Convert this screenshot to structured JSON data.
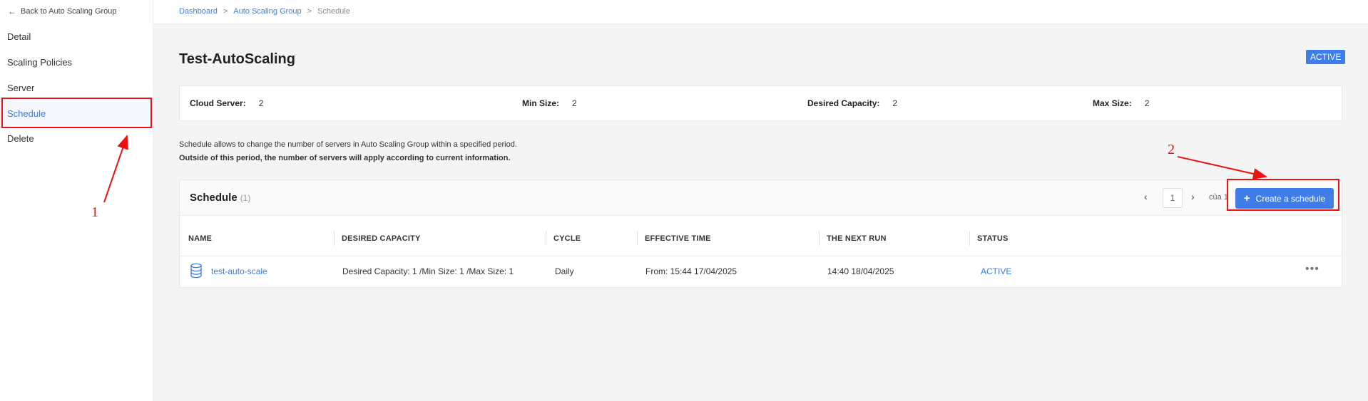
{
  "sidebar": {
    "back_label": "Back to Auto Scaling Group",
    "items": [
      {
        "label": "Detail"
      },
      {
        "label": "Scaling Policies"
      },
      {
        "label": "Server"
      },
      {
        "label": "Schedule"
      },
      {
        "label": "Delete"
      }
    ]
  },
  "breadcrumb": {
    "items": [
      "Dashboard",
      "Auto Scaling Group",
      "Schedule"
    ],
    "separator": ">"
  },
  "page": {
    "title": "Test-AutoScaling",
    "status": "ACTIVE"
  },
  "info": {
    "cloud_server_label": "Cloud Server:",
    "cloud_server_value": "2",
    "min_size_label": "Min Size:",
    "min_size_value": "2",
    "desired_label": "Desired Capacity:",
    "desired_value": "2",
    "max_size_label": "Max Size:",
    "max_size_value": "2"
  },
  "description": {
    "line1": "Schedule allows to change the number of servers in Auto Scaling Group within a specified period.",
    "line2": "Outside of this period, the number of servers will apply according to current information."
  },
  "schedule": {
    "title": "Schedule",
    "count": "(1)",
    "pager": {
      "prev": "‹",
      "page": "1",
      "next": "›",
      "of": "của 1"
    },
    "create_label": "Create a schedule",
    "columns": [
      "NAME",
      "DESIRED CAPACITY",
      "CYCLE",
      "EFFECTIVE TIME",
      "THE NEXT RUN",
      "STATUS"
    ],
    "rows": [
      {
        "name": "test-auto-scale",
        "desired_capacity": "Desired Capacity: 1 /Min Size: 1 /Max Size: 1",
        "cycle": "Daily",
        "effective_time": "From: 15:44 17/04/2025",
        "next_run": "14:40 18/04/2025",
        "status": "ACTIVE"
      }
    ]
  },
  "annotations": {
    "first": "1",
    "second": "2"
  },
  "colors": {
    "accent": "#3f7de8",
    "annotation": "#e11111"
  }
}
